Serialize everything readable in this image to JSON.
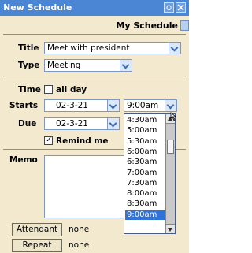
{
  "window": {
    "title": "New Schedule",
    "ok_icon": "ok-icon",
    "close_icon": "close-icon"
  },
  "calendar": {
    "name": "My Schedule"
  },
  "form": {
    "title_label": "Title",
    "title_value": "Meet with president",
    "type_label": "Type",
    "type_value": "Meeting",
    "time_label": "Time",
    "all_day_label": "all day",
    "all_day_checked": false,
    "starts_label": "Starts",
    "starts_date": "02-3-21",
    "starts_time": "9:00am",
    "due_label": "Due",
    "due_date": "02-3-21",
    "remind_label": "Remind me",
    "remind_checked": true,
    "memo_label": "Memo",
    "memo_value": ""
  },
  "time_list": {
    "options": [
      "4:30am",
      "5:00am",
      "5:30am",
      "6:00am",
      "6:30am",
      "7:00am",
      "7:30am",
      "8:00am",
      "8:30am",
      "9:00am"
    ],
    "selected": "9:00am"
  },
  "footer": {
    "attendant_label": "Attendant",
    "attendant_value": "none",
    "repeat_label": "Repeat",
    "repeat_value": "none"
  },
  "colors": {
    "titlebar": "#4a86d4",
    "panel": "#f2e9cf",
    "selection": "#2f73d8"
  }
}
